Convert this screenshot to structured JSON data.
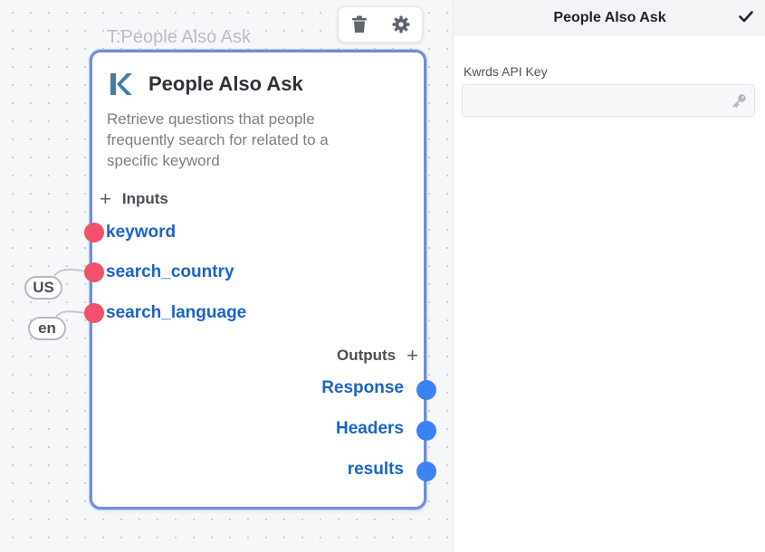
{
  "canvas": {
    "toolbar": {
      "delete_icon": "trash-icon",
      "settings_icon": "gear-icon"
    },
    "node": {
      "caption": "T:People Also Ask",
      "logo_letter": "K",
      "title": "People Also Ask",
      "description": "Retrieve questions that people frequently search for related to a specific keyword",
      "inputs_label": "Inputs",
      "outputs_label": "Outputs",
      "inputs": [
        "keyword",
        "search_country",
        "search_language"
      ],
      "outputs": [
        "Response",
        "Headers",
        "results"
      ],
      "attached_values": {
        "search_country": "US",
        "search_language": "en"
      }
    }
  },
  "panel": {
    "title": "People Also Ask",
    "field_label": "Kwrds API Key",
    "field_value": "",
    "field_placeholder": ""
  },
  "colors": {
    "input_port": "#f1516a",
    "output_port": "#3b82f6",
    "port_label": "#1a64c8",
    "node_border": "#6e8fdb"
  }
}
